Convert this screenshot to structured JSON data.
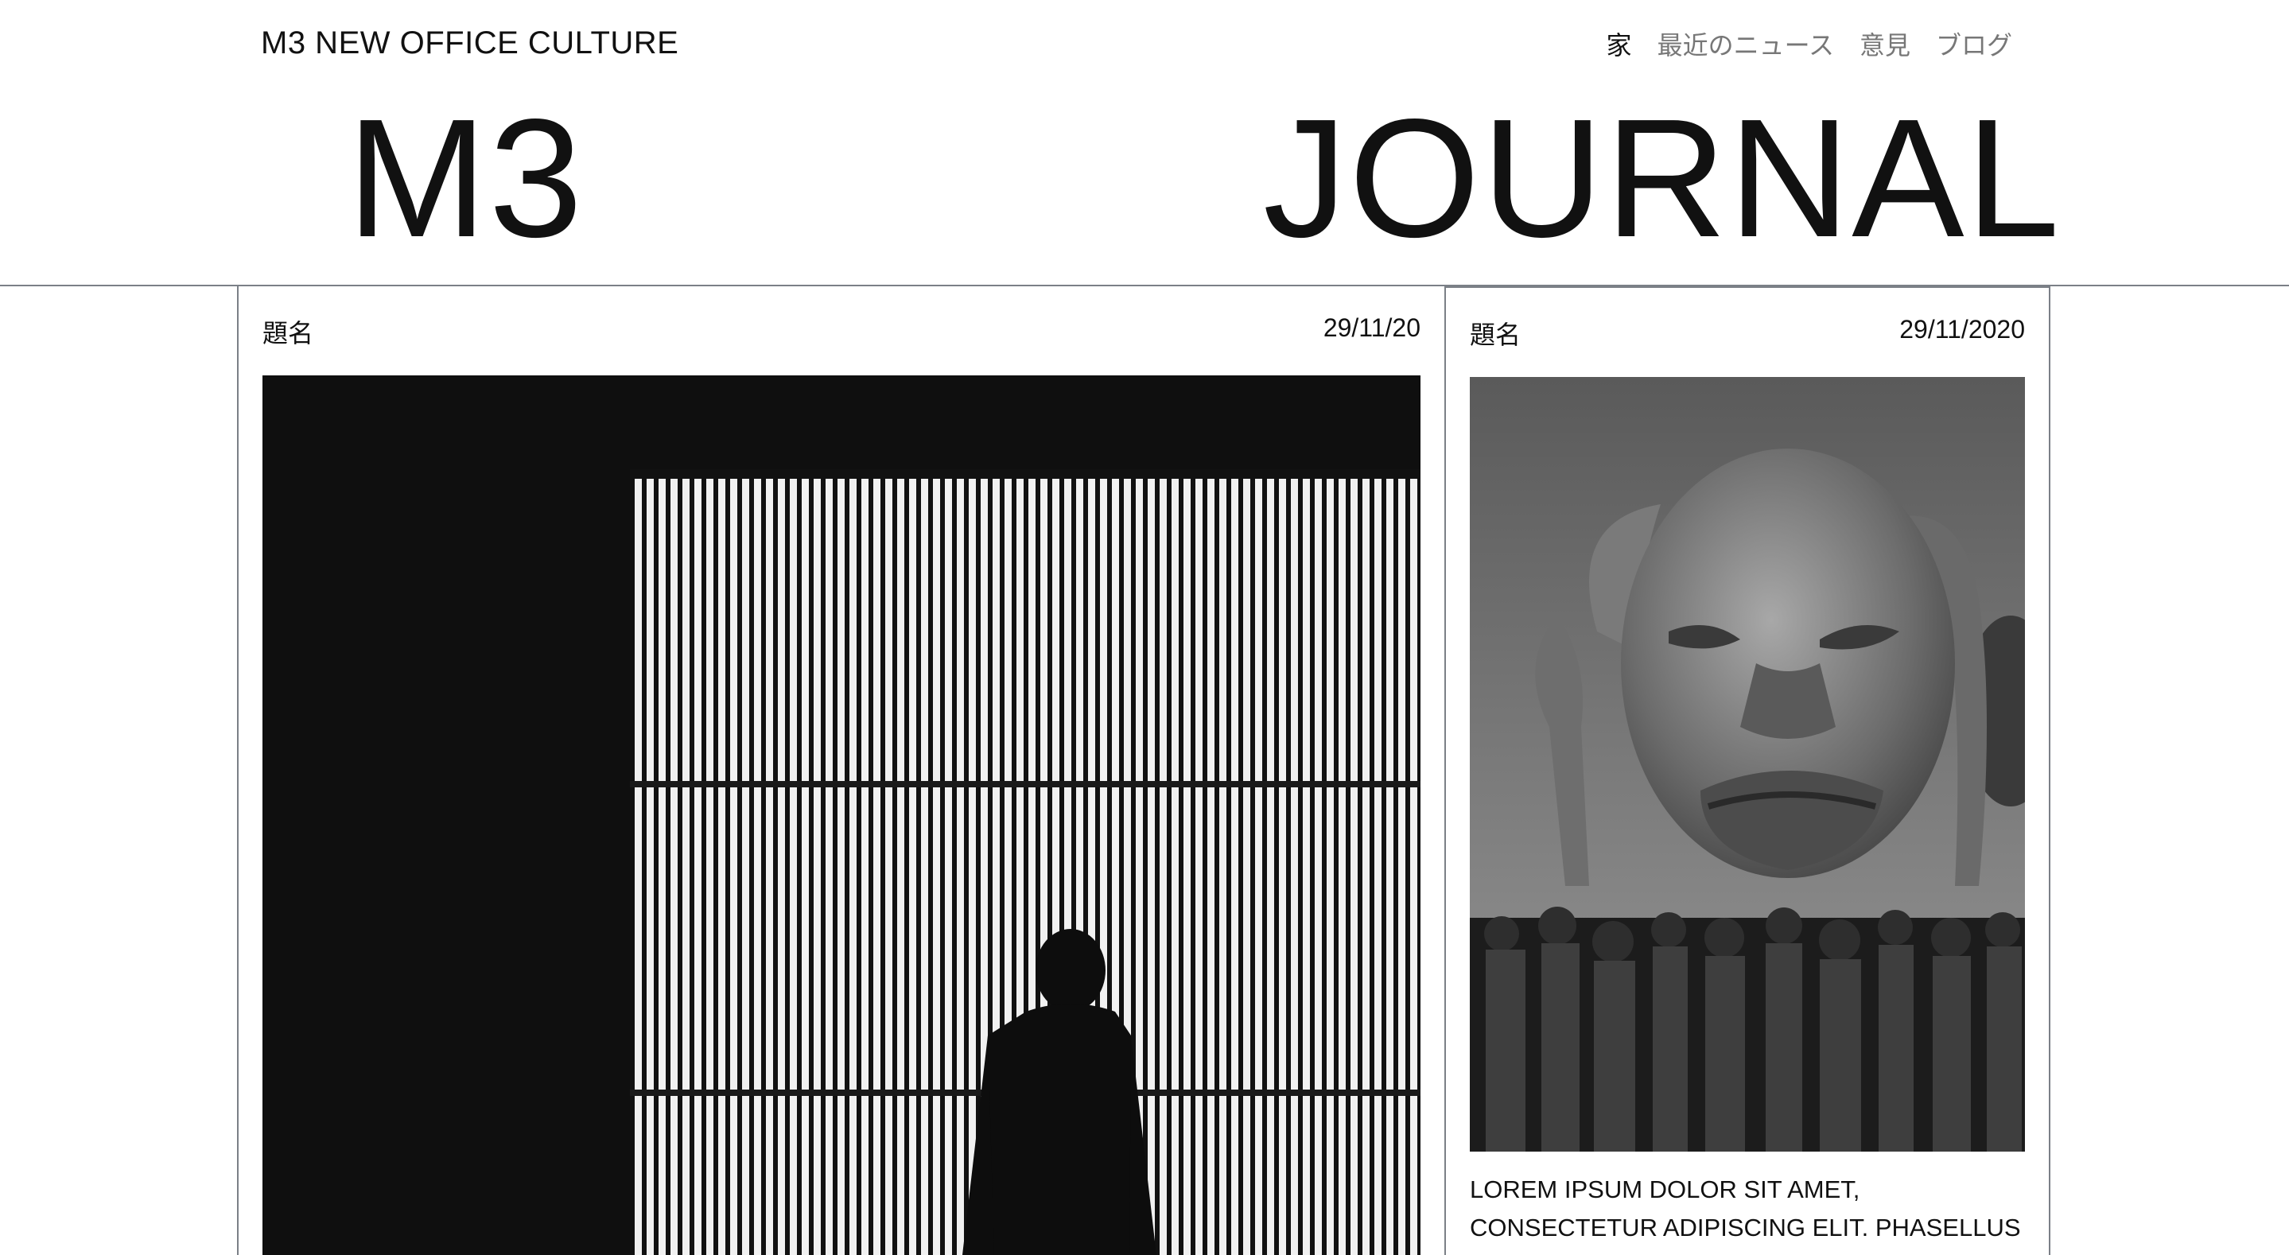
{
  "header": {
    "brand": "M3 NEW OFFICE CULTURE",
    "nav": [
      {
        "label": "家"
      },
      {
        "label": "最近のニュース"
      },
      {
        "label": "意見"
      },
      {
        "label": "ブログ"
      }
    ],
    "masthead_left": "M3",
    "masthead_right": "JOURNAL"
  },
  "cards": [
    {
      "title": "題名",
      "date": "29/11/20",
      "image": "silhouette-light-wall-photo"
    },
    {
      "title": "題名",
      "date": "29/11/2020",
      "image": "giant-inflatable-head-crowd-photo",
      "excerpt": "LOREM IPSUM DOLOR SIT AMET, CONSECTETUR ADIPISCING ELIT. PHASELLUS SIT AMET"
    }
  ]
}
